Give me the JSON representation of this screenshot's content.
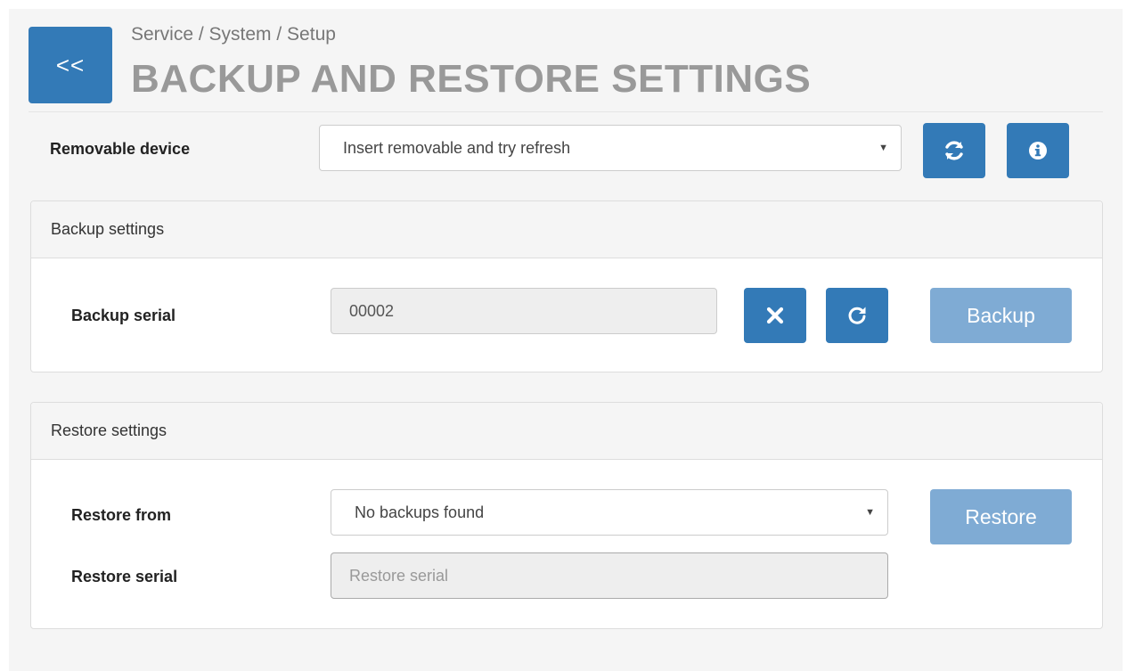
{
  "header": {
    "back_label": "<<",
    "breadcrumb": "Service / System / Setup",
    "title": "BACKUP AND RESTORE SETTINGS"
  },
  "device": {
    "label": "Removable device",
    "selected": "Insert removable and try refresh",
    "refresh_icon": "refresh-icon",
    "info_icon": "info-icon"
  },
  "backup": {
    "heading": "Backup settings",
    "serial_label": "Backup serial",
    "serial_value": "00002",
    "clear_icon": "times-icon",
    "reset_icon": "redo-icon",
    "button_label": "Backup"
  },
  "restore": {
    "heading": "Restore settings",
    "from_label": "Restore from",
    "from_selected": "No backups found",
    "serial_label": "Restore serial",
    "serial_placeholder": "Restore serial",
    "button_label": "Restore"
  },
  "colors": {
    "primary": "#337ab7",
    "primary_disabled": "#7fabd4",
    "title_gray": "#999999"
  }
}
